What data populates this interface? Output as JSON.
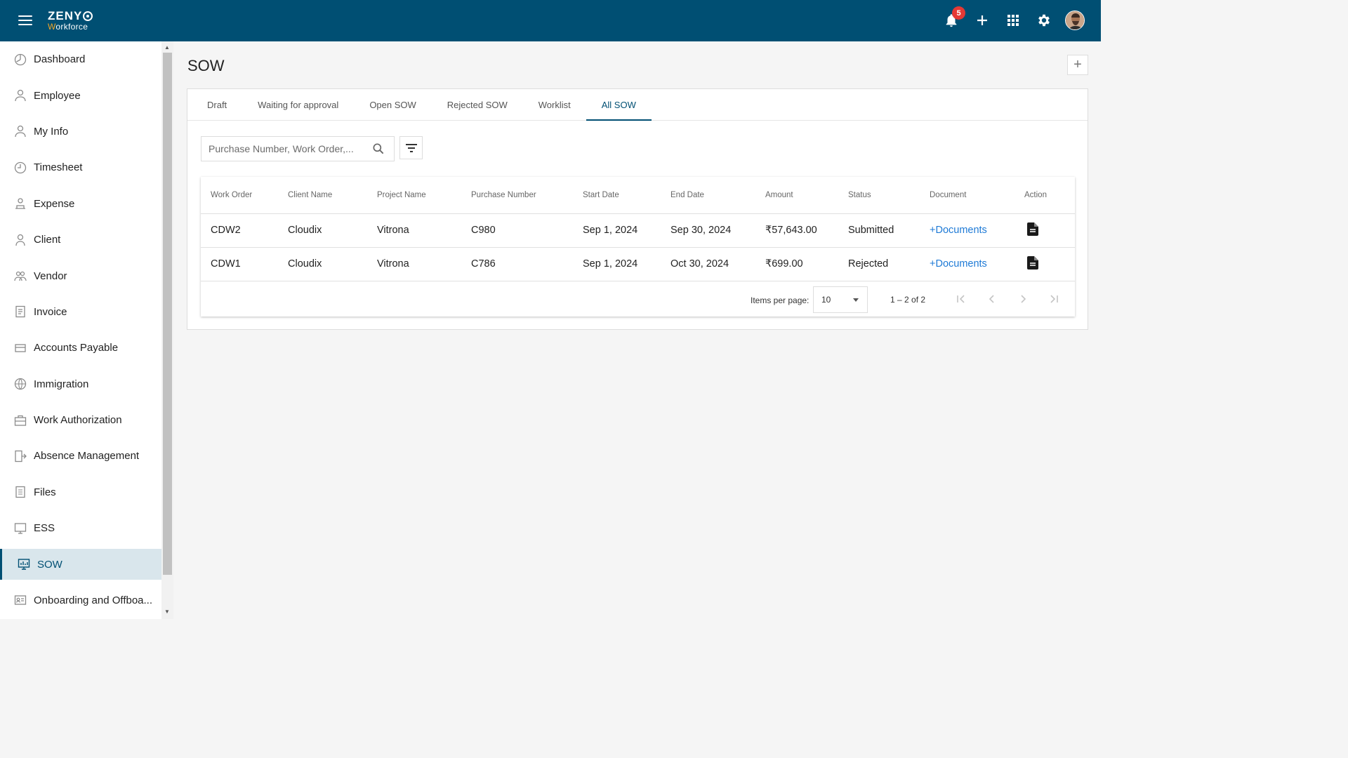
{
  "header": {
    "logo_brand": "ZENY",
    "logo_sub_w": "W",
    "logo_sub_rest": "orkforce",
    "notification_count": "5"
  },
  "sidebar": {
    "items": [
      {
        "label": "Dashboard",
        "icon": "dashboard-icon"
      },
      {
        "label": "Employee",
        "icon": "employee-icon"
      },
      {
        "label": "My Info",
        "icon": "my-info-icon"
      },
      {
        "label": "Timesheet",
        "icon": "timesheet-icon"
      },
      {
        "label": "Expense",
        "icon": "expense-icon"
      },
      {
        "label": "Client",
        "icon": "client-icon"
      },
      {
        "label": "Vendor",
        "icon": "vendor-icon"
      },
      {
        "label": "Invoice",
        "icon": "invoice-icon"
      },
      {
        "label": "Accounts Payable",
        "icon": "accounts-payable-icon"
      },
      {
        "label": "Immigration",
        "icon": "immigration-icon"
      },
      {
        "label": "Work Authorization",
        "icon": "work-authorization-icon"
      },
      {
        "label": "Absence Management",
        "icon": "absence-icon"
      },
      {
        "label": "Files",
        "icon": "files-icon"
      },
      {
        "label": "ESS",
        "icon": "ess-icon"
      },
      {
        "label": "SOW",
        "icon": "sow-icon"
      },
      {
        "label": "Onboarding and Offboa...",
        "icon": "onboarding-icon"
      }
    ],
    "active_index": 14
  },
  "page": {
    "title": "SOW",
    "tabs": [
      "Draft",
      "Waiting for approval",
      "Open SOW",
      "Rejected SOW",
      "Worklist",
      "All SOW"
    ],
    "active_tab": 5,
    "search_placeholder": "Purchase Number, Work Order,..."
  },
  "table": {
    "columns": [
      "Work Order",
      "Client Name",
      "Project Name",
      "Purchase Number",
      "Start Date",
      "End Date",
      "Amount",
      "Status",
      "Document",
      "Action"
    ],
    "rows": [
      {
        "work_order": "CDW2",
        "client": "Cloudix",
        "project": "Vitrona",
        "purchase": "C980",
        "start": "Sep 1, 2024",
        "end": "Sep 30, 2024",
        "amount": "₹57,643.00",
        "status": "Submitted",
        "document": "+Documents"
      },
      {
        "work_order": "CDW1",
        "client": "Cloudix",
        "project": "Vitrona",
        "purchase": "C786",
        "start": "Sep 1, 2024",
        "end": "Oct 30, 2024",
        "amount": "₹699.00",
        "status": "Rejected",
        "document": "+Documents"
      }
    ]
  },
  "paginator": {
    "items_per_page_label": "Items per page:",
    "items_per_page": "10",
    "range": "1 – 2 of 2"
  },
  "colors": {
    "header_bg": "#004f73",
    "accent": "#004f73",
    "link": "#1e7ad6",
    "badge": "#e53935"
  }
}
